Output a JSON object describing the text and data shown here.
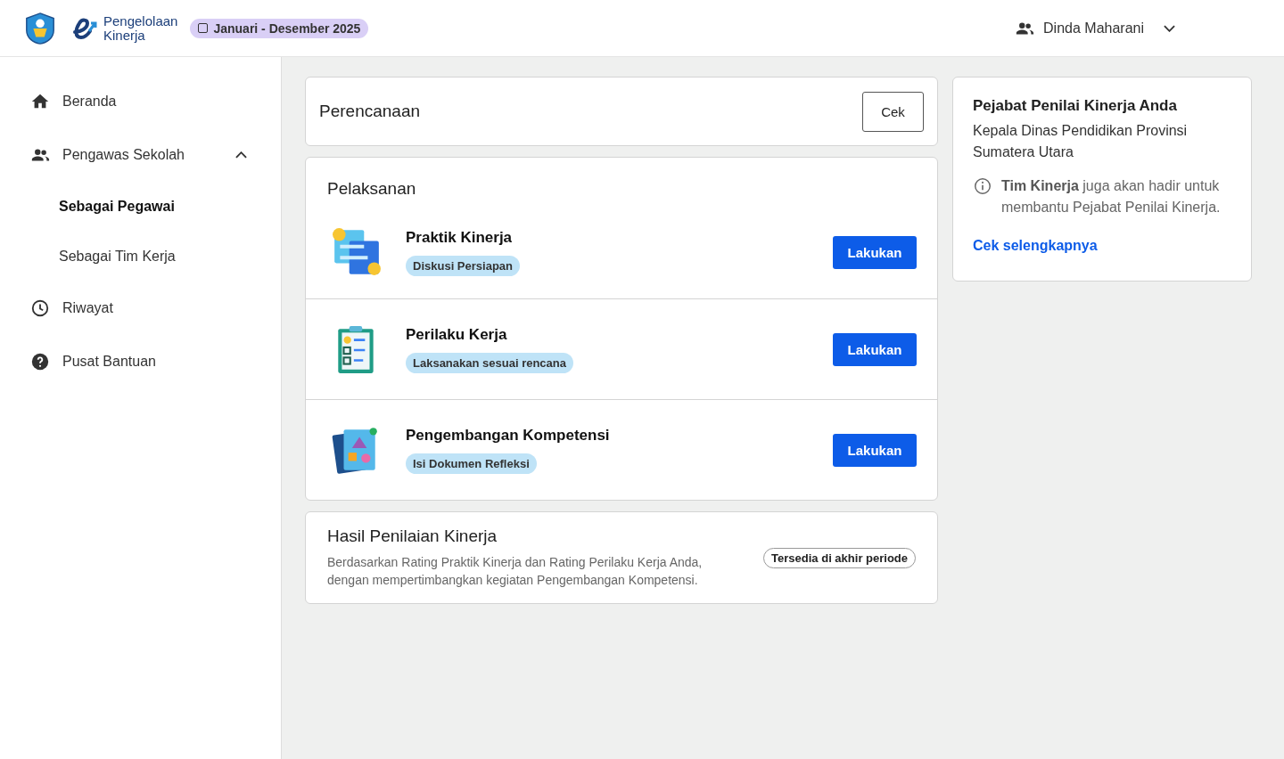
{
  "header": {
    "app_name_line1": "Pengelolaan",
    "app_name_line2": "Kinerja",
    "period": "Januari - Desember 2025",
    "user_name": "Dinda Maharani"
  },
  "sidebar": {
    "items": [
      {
        "label": "Beranda",
        "kind": "home",
        "selected": false
      },
      {
        "label": "Pengawas Sekolah",
        "kind": "people",
        "selected": false,
        "expanded": true,
        "children": [
          {
            "label": "Sebagai Pegawai",
            "selected": true
          },
          {
            "label": "Sebagai Tim Kerja",
            "selected": false
          }
        ]
      },
      {
        "label": "Riwayat",
        "kind": "clock",
        "selected": false
      },
      {
        "label": "Pusat Bantuan",
        "kind": "help",
        "selected": false
      }
    ]
  },
  "planning": {
    "title": "Perencanaan",
    "button": "Cek"
  },
  "execution": {
    "title": "Pelaksanan",
    "items": [
      {
        "kind": "practice",
        "title": "Praktik Kinerja",
        "status": "Diskusi Persiapan",
        "button": "Lakukan"
      },
      {
        "kind": "behavior",
        "title": "Perilaku Kerja",
        "status": "Laksanakan sesuai rencana",
        "button": "Lakukan"
      },
      {
        "kind": "competency",
        "title": "Pengembangan Kompetensi",
        "status": "Isi Dokumen Refleksi",
        "button": "Lakukan"
      }
    ]
  },
  "results": {
    "title": "Hasil Penilaian Kinerja",
    "description": "Berdasarkan Rating Praktik Kinerja dan Rating Perilaku Kerja Anda, dengan mempertimbangkan kegiatan Pengembangan Kompetensi.",
    "badge": "Tersedia di akhir periode"
  },
  "assessor": {
    "title": "Pejabat Penilai Kinerja Anda",
    "name": "Kepala Dinas Pendidikan Provinsi Sumatera Utara",
    "note": "**Tim Kinerja** juga akan hadir untuk membantu Pejabat Penilai Kinerja.",
    "link": "Cek selengkapnya"
  }
}
